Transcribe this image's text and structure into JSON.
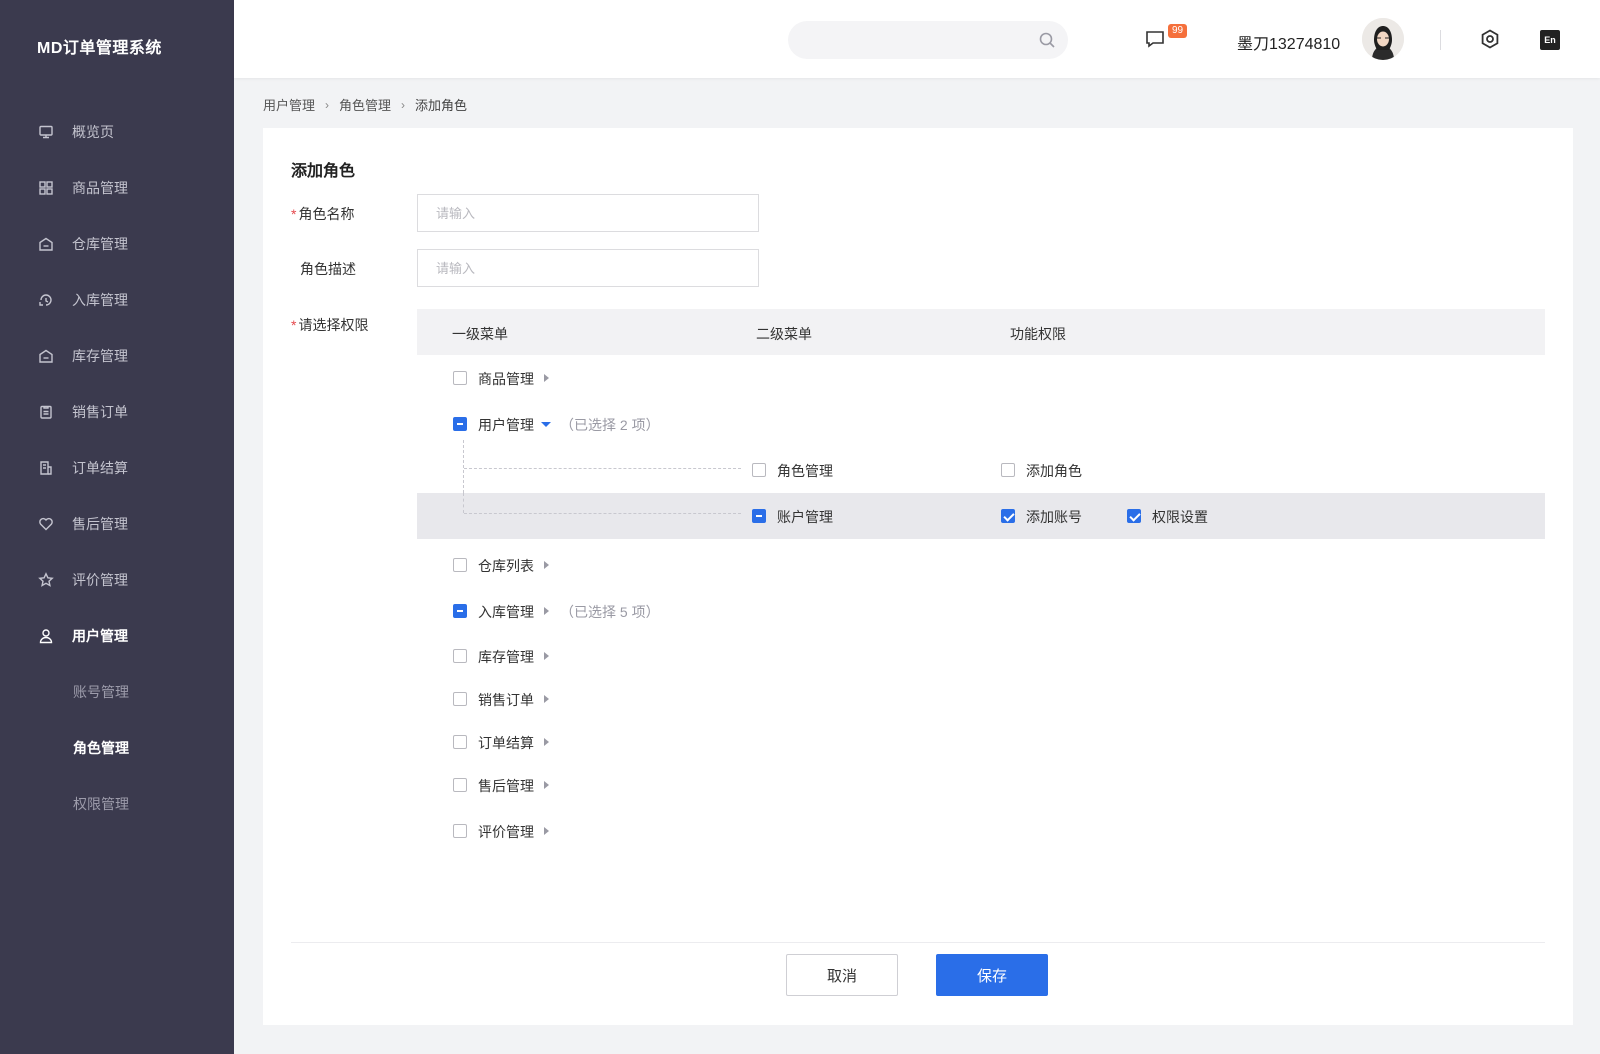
{
  "app": {
    "title": "MD订单管理系统"
  },
  "sidebar": {
    "items": [
      {
        "label": "概览页",
        "icon": "monitor-icon"
      },
      {
        "label": "商品管理",
        "icon": "grid-icon"
      },
      {
        "label": "仓库管理",
        "icon": "warehouse-icon"
      },
      {
        "label": "入库管理",
        "icon": "inbound-icon"
      },
      {
        "label": "库存管理",
        "icon": "stock-icon"
      },
      {
        "label": "销售订单",
        "icon": "clipboard-icon"
      },
      {
        "label": "订单结算",
        "icon": "receipt-icon"
      },
      {
        "label": "售后管理",
        "icon": "heart-icon"
      },
      {
        "label": "评价管理",
        "icon": "star-icon"
      },
      {
        "label": "用户管理",
        "icon": "user-icon"
      }
    ],
    "subitems": [
      "账号管理",
      "角色管理",
      "权限管理"
    ],
    "active_item": "用户管理",
    "active_subitem": "角色管理"
  },
  "header": {
    "search_placeholder": "",
    "message_badge": "99",
    "username": "墨刀13274810",
    "lang": "En"
  },
  "breadcrumb": [
    "用户管理",
    "角色管理",
    "添加角色"
  ],
  "form": {
    "title": "添加角色",
    "role_name_label": "角色名称",
    "role_name_placeholder": "请输入",
    "role_desc_label": "角色描述",
    "role_desc_placeholder": "请输入",
    "perm_label": "请选择权限",
    "required_mark": "*"
  },
  "permissions": {
    "headers": [
      "一级菜单",
      "二级菜单",
      "功能权限"
    ],
    "rows": [
      {
        "label": "商品管理",
        "state": "unchecked"
      },
      {
        "label": "用户管理",
        "state": "partial",
        "note": "（已选择 2 项）"
      },
      {
        "label": "仓库列表",
        "state": "unchecked"
      },
      {
        "label": "入库管理",
        "state": "partial",
        "note": "（已选择 5 项）"
      },
      {
        "label": "库存管理",
        "state": "unchecked"
      },
      {
        "label": "销售订单",
        "state": "unchecked"
      },
      {
        "label": "订单结算",
        "state": "unchecked"
      },
      {
        "label": "售后管理",
        "state": "unchecked"
      },
      {
        "label": "评价管理",
        "state": "unchecked"
      }
    ],
    "children": [
      {
        "label": "角色管理",
        "state": "unchecked",
        "functions": [
          {
            "label": "添加角色",
            "state": "unchecked"
          }
        ]
      },
      {
        "label": "账户管理",
        "state": "partial",
        "functions": [
          {
            "label": "添加账号",
            "state": "checked"
          },
          {
            "label": "权限设置",
            "state": "checked"
          }
        ]
      }
    ]
  },
  "actions": {
    "cancel": "取消",
    "save": "保存"
  },
  "colors": {
    "sidebar_bg": "#3b3a4e",
    "primary": "#2a6ee8",
    "badge": "#f5703c"
  }
}
